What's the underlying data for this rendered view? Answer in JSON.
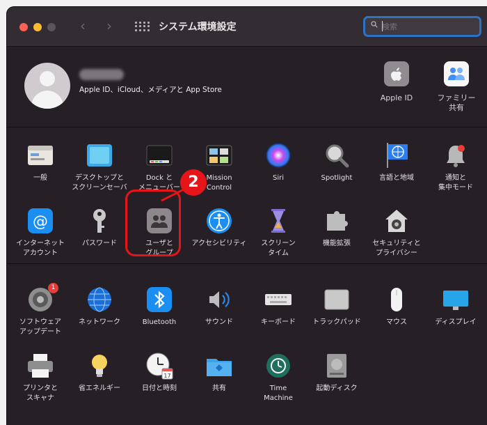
{
  "window": {
    "title": "システム環境設定",
    "search_placeholder": "検索"
  },
  "account": {
    "subtitle": "Apple ID、iCloud、メディアと App Store",
    "apple_id": "Apple ID",
    "family": "ファミリー\n共有"
  },
  "row1": [
    {
      "label": "一般"
    },
    {
      "label": "デスクトップと\nスクリーンセーバ"
    },
    {
      "label": "Dock と\nメニューバー"
    },
    {
      "label": "Mission\nControl"
    },
    {
      "label": "Siri"
    },
    {
      "label": "Spotlight"
    },
    {
      "label": "言語と地域"
    },
    {
      "label": "通知と\n集中モード"
    }
  ],
  "row2": [
    {
      "label": "インターネット\nアカウント"
    },
    {
      "label": "パスワード"
    },
    {
      "label": "ユーザと\nグループ"
    },
    {
      "label": "アクセシビリティ"
    },
    {
      "label": "スクリーン\nタイム"
    },
    {
      "label": "機能拡張"
    },
    {
      "label": "セキュリティと\nプライバシー"
    }
  ],
  "row3": [
    {
      "label": "ソフトウェア\nアップデート",
      "badge": "1"
    },
    {
      "label": "ネットワーク"
    },
    {
      "label": "Bluetooth"
    },
    {
      "label": "サウンド"
    },
    {
      "label": "キーボード"
    },
    {
      "label": "トラックパッド"
    },
    {
      "label": "マウス"
    },
    {
      "label": "ディスプレイ"
    }
  ],
  "row4": [
    {
      "label": "プリンタと\nスキャナ"
    },
    {
      "label": "省エネルギー"
    },
    {
      "label": "日付と時刻"
    },
    {
      "label": "共有"
    },
    {
      "label": "Time\nMachine"
    },
    {
      "label": "起動ディスク"
    }
  ],
  "annotation": {
    "step": "2"
  },
  "calendar_day": "17",
  "colors": {
    "highlight": "#e5151a",
    "accent": "#2c72c5",
    "window_bg": "#262026"
  }
}
